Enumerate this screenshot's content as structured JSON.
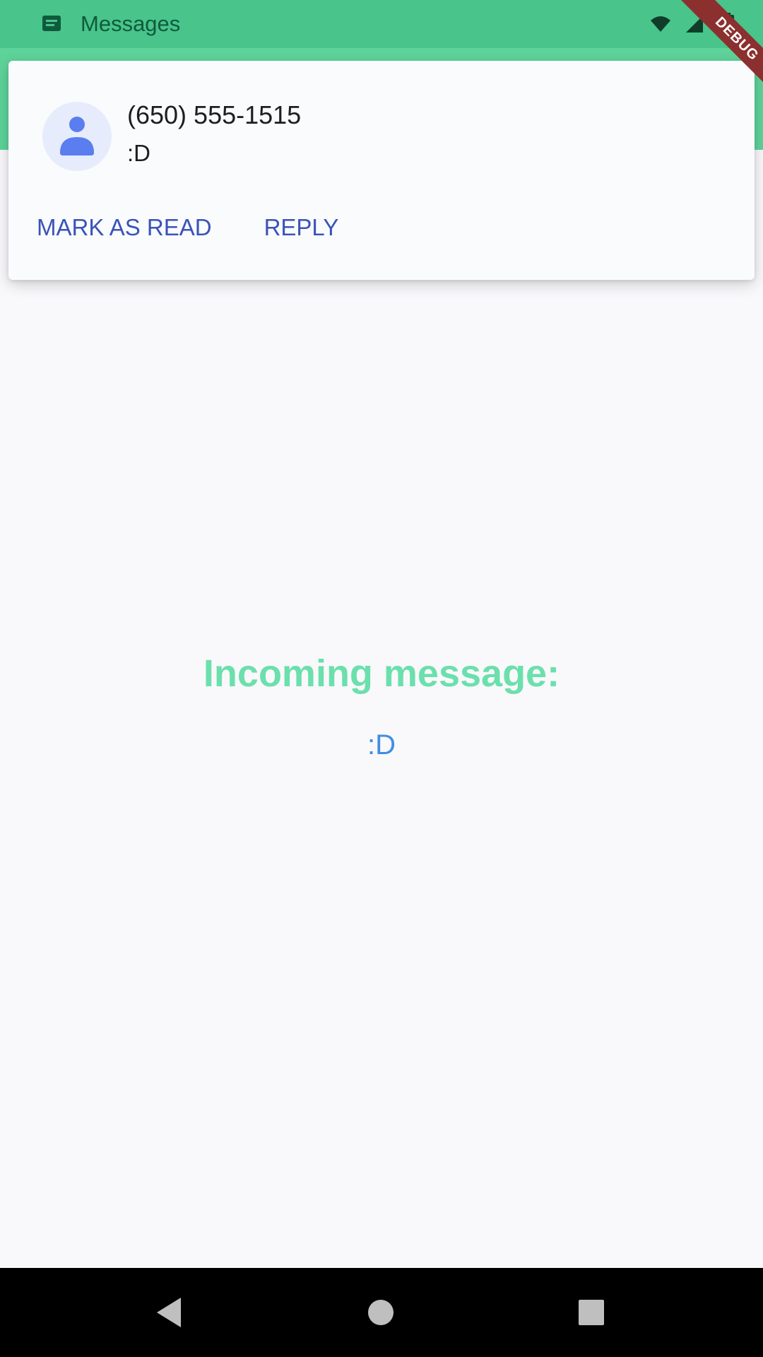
{
  "status_bar": {
    "app_label": "Messages",
    "app_icon": "messages-app-icon",
    "debug_banner": "DEBUG",
    "icons": [
      "wifi-icon",
      "signal-icon",
      "battery-icon"
    ]
  },
  "notification": {
    "title": "(650) 555-1515",
    "text": ":D",
    "avatar_icon": "person-icon",
    "actions": [
      {
        "label": "MARK AS READ"
      },
      {
        "label": "REPLY"
      }
    ]
  },
  "main": {
    "heading": "Incoming message:",
    "message": ":D"
  },
  "nav_bar": {
    "buttons": [
      "back-icon",
      "home-icon",
      "recents-icon"
    ]
  },
  "colors": {
    "app_bar": "#5ed39a",
    "status_bar": "#49c48a",
    "heading": "#6be0ad",
    "message": "#3f8fe0",
    "action": "#3b53b8"
  }
}
